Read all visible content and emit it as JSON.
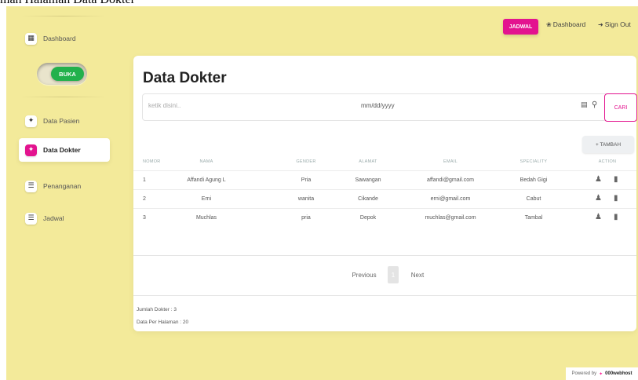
{
  "caption": "man Halaman Data Dokter",
  "sidebar": {
    "items": [
      {
        "label": "Dashboard",
        "icon": "building-icon"
      },
      {
        "label": "Data Pasien",
        "icon": "user-plus-icon"
      },
      {
        "label": "Data Dokter",
        "icon": "user-plus-icon"
      },
      {
        "label": "Penanganan",
        "icon": "list-icon"
      },
      {
        "label": "Jadwal",
        "icon": "list-icon"
      }
    ],
    "toggle_label": "BUKA"
  },
  "topnav": {
    "jadwal": "JADWAL",
    "dashboard": "Dashboard",
    "signout": "Sign Out"
  },
  "main": {
    "title": "Data Dokter",
    "search_placeholder": "ketik disini..",
    "date_placeholder": "mm/dd/yyyy",
    "search_button": "CARI",
    "add_button": "+ TAMBAH",
    "columns": [
      "NOMOR",
      "NAMA",
      "GENDER",
      "ALAMAT",
      "EMAIL",
      "SPECIALITY",
      "ACTION"
    ],
    "rows": [
      {
        "no": "1",
        "nama": "Affandi Agung L",
        "gender": "Pria",
        "alamat": "Sawangan",
        "email": "affandi@gmail.com",
        "speciality": "Bedah Gigi"
      },
      {
        "no": "2",
        "nama": "Erni",
        "gender": "wanita",
        "alamat": "Cikande",
        "email": "erni@gmail.com",
        "speciality": "Cabut"
      },
      {
        "no": "3",
        "nama": "Muchlas",
        "gender": "pria",
        "alamat": "Depok",
        "email": "muchlas@gmail.com",
        "speciality": "Tambal"
      }
    ],
    "pagination": {
      "previous": "Previous",
      "current": "1",
      "next": "Next"
    },
    "footer": {
      "jumlah": "Jumlah Dokter : 3",
      "per_halaman": "Data Per Halaman : 20"
    }
  },
  "powered": {
    "text": "Powered by",
    "brand": "000webhost"
  },
  "colors": {
    "background": "#f3ea9a",
    "accent": "#e3138f",
    "toggle": "#22b14c"
  }
}
